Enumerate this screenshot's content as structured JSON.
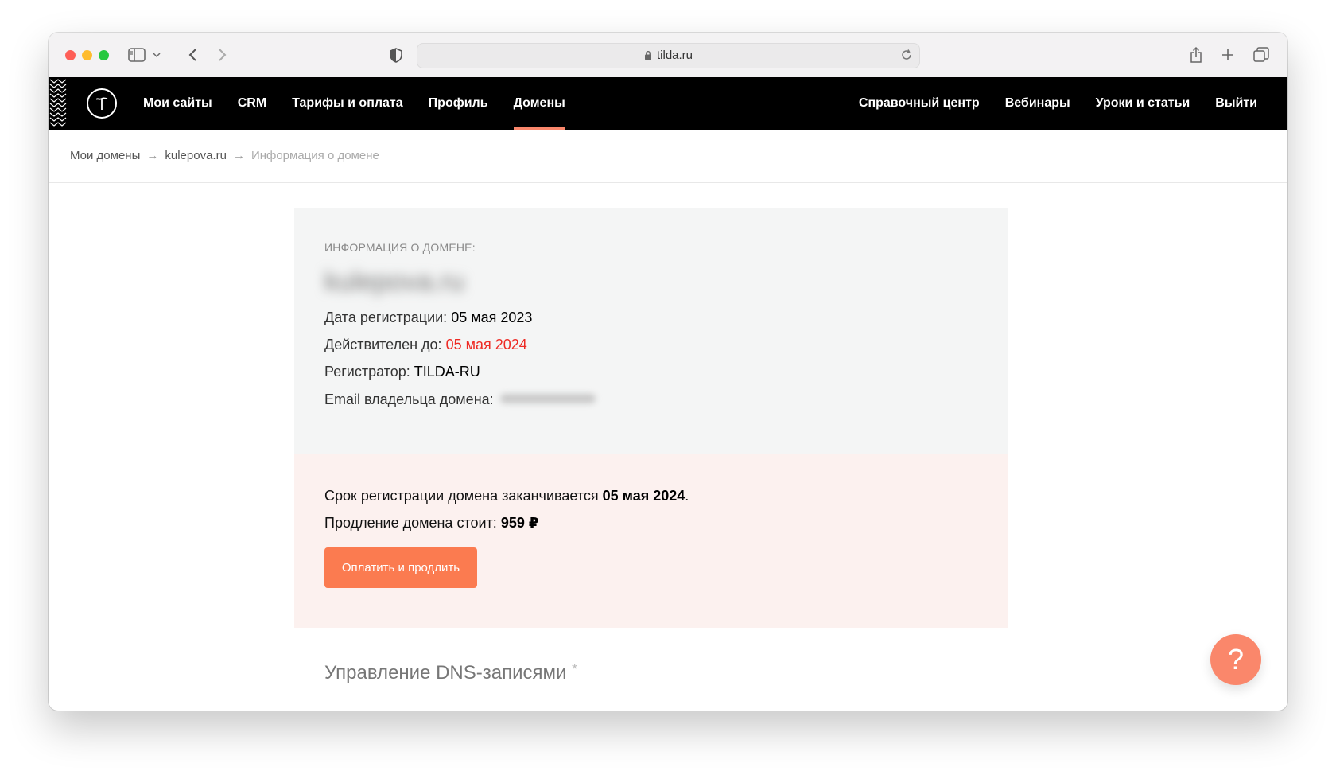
{
  "browser": {
    "url": "tilda.ru",
    "lock_icon": "lock-icon",
    "toolbar_icons": [
      "sidebar-icon",
      "chevron-down-icon",
      "back-icon",
      "forward-icon",
      "shield-icon",
      "reload-icon",
      "share-icon",
      "plus-icon",
      "tabs-icon"
    ]
  },
  "nav": {
    "left": [
      {
        "label": "Мои сайты"
      },
      {
        "label": "CRM"
      },
      {
        "label": "Тарифы и оплата"
      },
      {
        "label": "Профиль"
      },
      {
        "label": "Домены",
        "active": true
      }
    ],
    "right": [
      {
        "label": "Справочный центр"
      },
      {
        "label": "Вебинары"
      },
      {
        "label": "Уроки и статьи"
      },
      {
        "label": "Выйти"
      }
    ]
  },
  "breadcrumb": {
    "items": [
      "Мои домены",
      "kulepova.ru"
    ],
    "separator": "→",
    "current": "Информация о домене"
  },
  "info": {
    "label": "ИНФОРМАЦИЯ О ДОМЕНЕ:",
    "domain": "kulepova.ru",
    "reg_date_label": "Дата регистрации:",
    "reg_date": "05 мая 2023",
    "valid_label": "Действителен до:",
    "valid_until": "05 мая 2024",
    "registrar_label": "Регистратор:",
    "registrar": "TILDA-RU",
    "email_label": "Email владельца домена:"
  },
  "renew": {
    "expires_text": "Срок регистрации домена заканчивается",
    "expires_date": "05 мая 2024",
    "price_label": "Продление домена стоит:",
    "price": "959 ₽",
    "button": "Оплатить и продлить"
  },
  "dns": {
    "title": "Управление DNS-записями",
    "star": "*"
  },
  "help": {
    "label": "?"
  },
  "colors": {
    "accent": "#fa876b",
    "button": "#fb7b50",
    "expiry_red": "#ee2a24",
    "header_bg": "#000000"
  }
}
